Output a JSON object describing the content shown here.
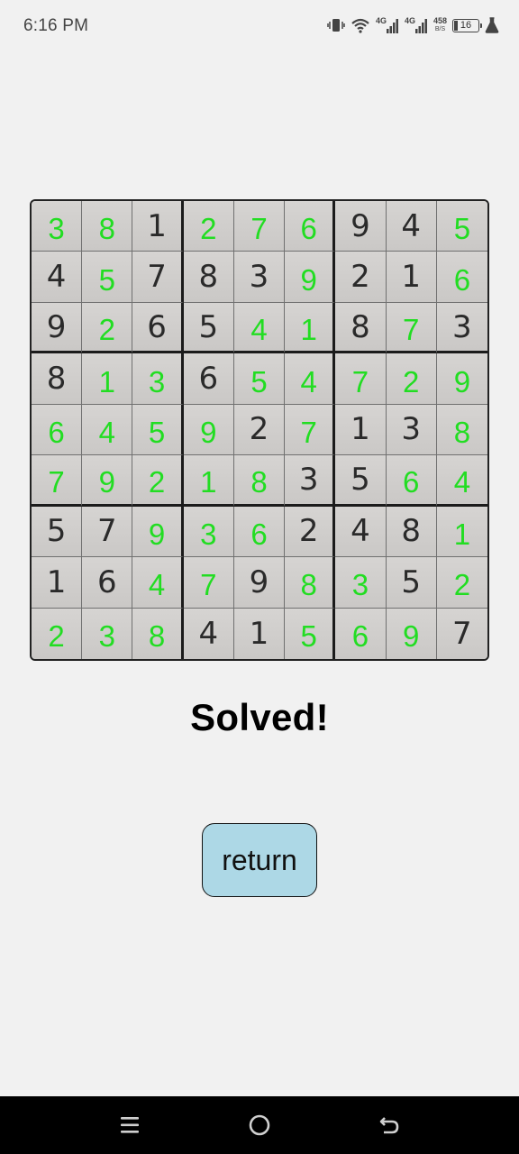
{
  "status_bar": {
    "time": "6:16 PM",
    "network_speed_value": "458",
    "network_speed_unit": "B/S",
    "battery_level": "16",
    "signal_labels": [
      "4G",
      "4G"
    ]
  },
  "puzzle": {
    "grid": [
      [
        3,
        8,
        1,
        2,
        7,
        6,
        9,
        4,
        5
      ],
      [
        4,
        5,
        7,
        8,
        3,
        9,
        2,
        1,
        6
      ],
      [
        9,
        2,
        6,
        5,
        4,
        1,
        8,
        7,
        3
      ],
      [
        8,
        1,
        3,
        6,
        5,
        4,
        7,
        2,
        9
      ],
      [
        6,
        4,
        5,
        9,
        2,
        7,
        1,
        3,
        8
      ],
      [
        7,
        9,
        2,
        1,
        8,
        3,
        5,
        6,
        4
      ],
      [
        5,
        7,
        9,
        3,
        6,
        2,
        4,
        8,
        1
      ],
      [
        1,
        6,
        4,
        7,
        9,
        8,
        3,
        5,
        2
      ],
      [
        2,
        3,
        8,
        4,
        1,
        5,
        6,
        9,
        7
      ]
    ],
    "given": [
      [
        0,
        0,
        1,
        0,
        0,
        0,
        1,
        1,
        0
      ],
      [
        1,
        0,
        1,
        1,
        1,
        0,
        1,
        1,
        0
      ],
      [
        1,
        0,
        1,
        1,
        0,
        0,
        1,
        0,
        1
      ],
      [
        1,
        0,
        0,
        1,
        0,
        0,
        0,
        0,
        0
      ],
      [
        0,
        0,
        0,
        0,
        1,
        0,
        1,
        1,
        0
      ],
      [
        0,
        0,
        0,
        0,
        0,
        1,
        1,
        0,
        0
      ],
      [
        1,
        1,
        0,
        0,
        0,
        1,
        1,
        1,
        0
      ],
      [
        1,
        1,
        0,
        0,
        1,
        0,
        0,
        1,
        0
      ],
      [
        0,
        0,
        0,
        1,
        1,
        0,
        0,
        0,
        1
      ]
    ],
    "colors": {
      "given": "#2a2a2a",
      "solved": "#22dd22"
    }
  },
  "result": {
    "text": "Solved!"
  },
  "actions": {
    "return_label": "return"
  },
  "colors": {
    "background": "#f1f1f1",
    "button": "#add8e6",
    "nav_bar": "#000000"
  },
  "icons": {
    "status": [
      "vibrate-icon",
      "wifi-icon",
      "signal-4g-icon",
      "signal-4g-icon",
      "battery-icon",
      "lab-flask-icon"
    ],
    "navigation": [
      "menu-icon",
      "home-icon",
      "back-icon"
    ]
  }
}
